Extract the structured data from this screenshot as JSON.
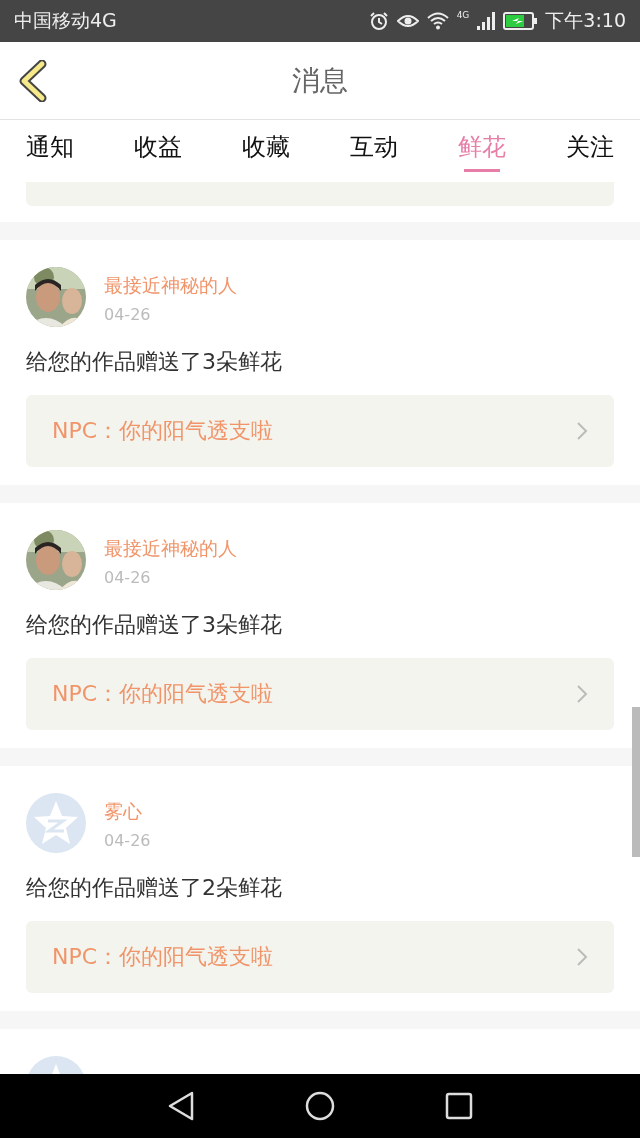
{
  "status_bar": {
    "carrier": "中国移动4G",
    "network": "4G",
    "time": "下午3:10"
  },
  "header": {
    "title": "消息"
  },
  "tabs": [
    {
      "label": "通知",
      "selected": false
    },
    {
      "label": "收益",
      "selected": false
    },
    {
      "label": "收藏",
      "selected": false
    },
    {
      "label": "互动",
      "selected": false
    },
    {
      "label": "鲜花",
      "selected": true
    },
    {
      "label": "关注",
      "selected": false
    }
  ],
  "messages": [
    {
      "name": "最接近神秘的人",
      "date": "04-26",
      "text": "给您的作品赠送了3朵鲜花",
      "work": "NPC：你的阳气透支啦"
    },
    {
      "name": "最接近神秘的人",
      "date": "04-26",
      "text": "给您的作品赠送了3朵鲜花",
      "work": "NPC：你的阳气透支啦"
    },
    {
      "kind": "default",
      "name": "雾心",
      "date": "04-26",
      "text": "给您的作品赠送了2朵鲜花",
      "work": "NPC：你的阳气透支啦"
    },
    {
      "kind": "default"
    }
  ]
}
